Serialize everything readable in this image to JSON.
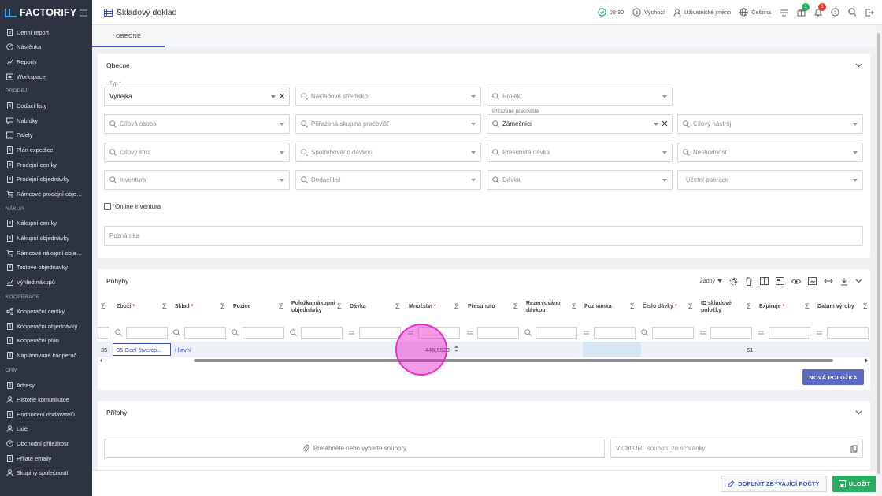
{
  "app": {
    "brand": "FACTORIFY",
    "page_title": "Skladový doklad"
  },
  "topbar": {
    "time": "08:30",
    "shift": "Výchozí",
    "user": "Uživatelské jméno",
    "language": "Čeština",
    "gift_badge": "1",
    "bell_badge": "1"
  },
  "sidebar": {
    "groups": [
      {
        "section": "",
        "items": [
          "Denní report",
          "Nástěnka",
          "Reporty",
          "Workspace"
        ]
      },
      {
        "section": "PRODEJ",
        "items": [
          "Dodací listy",
          "Nabídky",
          "Palety",
          "Plán expedice",
          "Prodejní ceníky",
          "Prodejní objednávky",
          "Rámcové prodejní objednávky"
        ]
      },
      {
        "section": "NÁKUP",
        "items": [
          "Nákupní ceníky",
          "Nákupní objednávky",
          "Rámcové nákupní objednávky",
          "Textové objednávky",
          "Výhled nákupů"
        ]
      },
      {
        "section": "KOOPERACE",
        "items": [
          "Kooperační ceníky",
          "Kooperační objednávky",
          "Kooperační plán",
          "Naplánované kooperační operace"
        ]
      },
      {
        "section": "CRM",
        "items": [
          "Adresy",
          "Historie komunikace",
          "Hodnocení dodavatelů",
          "Lidé",
          "Obchodní příležitosti",
          "Přijaté emaily",
          "Skupiny společností"
        ]
      }
    ]
  },
  "tabs": {
    "general": "OBECNÉ"
  },
  "general": {
    "title": "Obecné",
    "type_label": "Typ *",
    "type_value": "Výdejka",
    "cost_center": "Nákladové středisko",
    "project": "Projekt",
    "target_person": "Cílová osoba",
    "workplace_group": "Přiřazená skupina pracovišť",
    "workplace_label": "Přiřazené pracoviště",
    "workplace_value": "Zámečníci",
    "target_tool": "Cílový nástroj",
    "target_machine": "Cílový stroj",
    "consumed_by_batch": "Spotřebováno dávkou",
    "moved_batch": "Přesunutá dávka",
    "nonconformity": "Neshodnost",
    "inventory": "Inventura",
    "delivery_note": "Dodací list",
    "batch": "Dávka",
    "accounting_operation": "Účetní operace",
    "online_inventory": "Online inventura",
    "note": "Poznámka"
  },
  "movements": {
    "title": "Pohyby",
    "grouping": "Žádný",
    "columns": [
      "Zboží *",
      "Sklad *",
      "Pozice",
      "Položka nákupní objednávky",
      "Dávka",
      "Množství *",
      "Přesunuto",
      "Rezervováno dávkou",
      "Poznámka",
      "Číslo dávky *",
      "ID skladové položky",
      "Expiruje *",
      "Datum výroby"
    ],
    "row": {
      "index": "35",
      "item": "35 Ocel čtverco...",
      "warehouse": "Hlavní",
      "quantity": "446,6528",
      "stock_id": "61"
    },
    "new_item": "NOVÁ POLOŽKA"
  },
  "attachments": {
    "title": "Přílohy",
    "drop": "Přetáhněte nebo vyberte soubory",
    "url": "Vložit URL souboru ze schránky"
  },
  "footer": {
    "fill_missing": "DOPLNIT ZBÝVAJÍCÍ POČTY",
    "save": "ULOŽIT"
  },
  "colors": {
    "sidebar": "#2d3340",
    "accent": "#3f51b5",
    "primary_button": "#5c6bc0",
    "save": "#27ae60",
    "click_marker": "#e91ec8"
  }
}
